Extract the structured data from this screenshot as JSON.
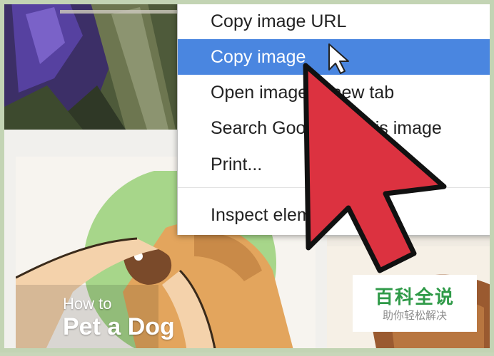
{
  "context_menu": {
    "items": [
      {
        "label": "Copy image URL",
        "highlighted": false
      },
      {
        "label": "Copy image",
        "highlighted": true
      },
      {
        "label": "Open image in new tab",
        "highlighted": false
      },
      {
        "label": "Search Google for this image",
        "highlighted": false
      },
      {
        "label": "Print...",
        "highlighted": false
      },
      {
        "label": "Inspect element",
        "highlighted": false
      }
    ]
  },
  "card": {
    "subtitle": "How to",
    "title": "Pet a Dog"
  },
  "watermark": {
    "title": "百科全说",
    "subtitle": "助你轻松解决"
  },
  "colors": {
    "menu_highlight": "#4a86e0",
    "arrow_fill": "#dc3240",
    "watermark_green": "#2f9a48",
    "frame_border": "#c3d4b4"
  },
  "icons": [
    "mouse-cursor-icon",
    "large-arrow-pointer-icon"
  ]
}
